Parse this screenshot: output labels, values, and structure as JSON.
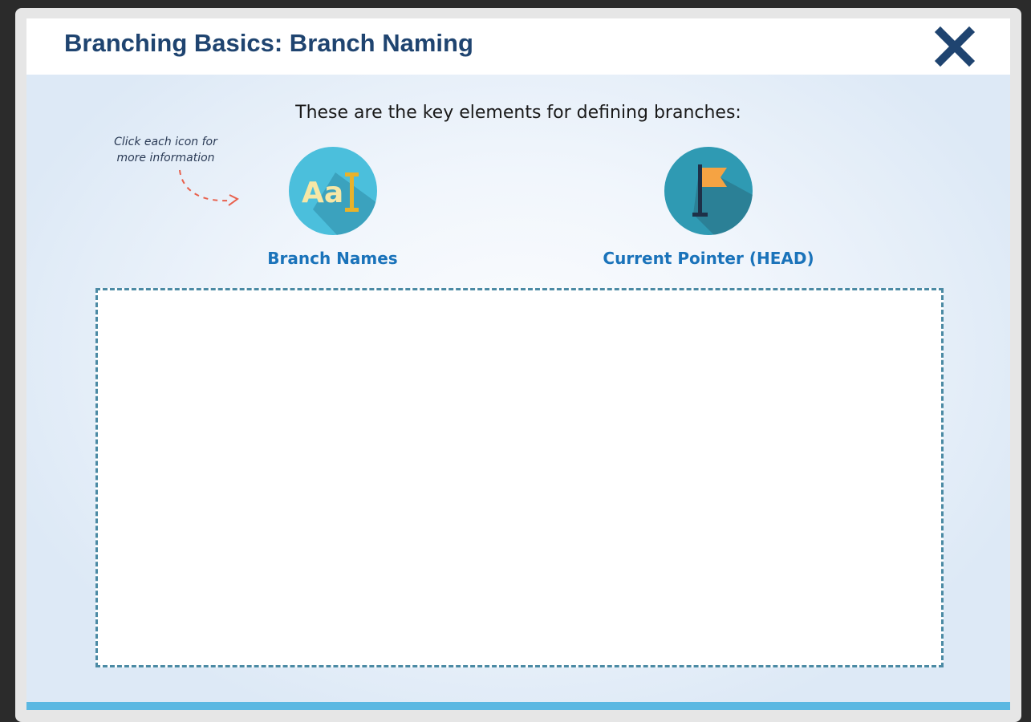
{
  "header": {
    "title": "Branching Basics: Branch Naming",
    "close_icon": "close-x-icon"
  },
  "content": {
    "intro": "These are the key elements for defining branches:",
    "hint": "Click each icon for more information",
    "items": [
      {
        "label": "Branch Names",
        "icon": "text-font-icon",
        "icon_text": "Aa"
      },
      {
        "label": "Current Pointer (HEAD)",
        "icon": "flag-icon"
      }
    ]
  },
  "colors": {
    "title": "#1f4470",
    "label": "#1a73ba",
    "icon_circle_names": "#4bbfdc",
    "icon_circle_pointer": "#2f9ab3",
    "flag": "#f5a343",
    "dashed_border": "#4b8aa4",
    "footer_bar": "#5bb8e2",
    "hint_arrow": "#e8604c"
  }
}
